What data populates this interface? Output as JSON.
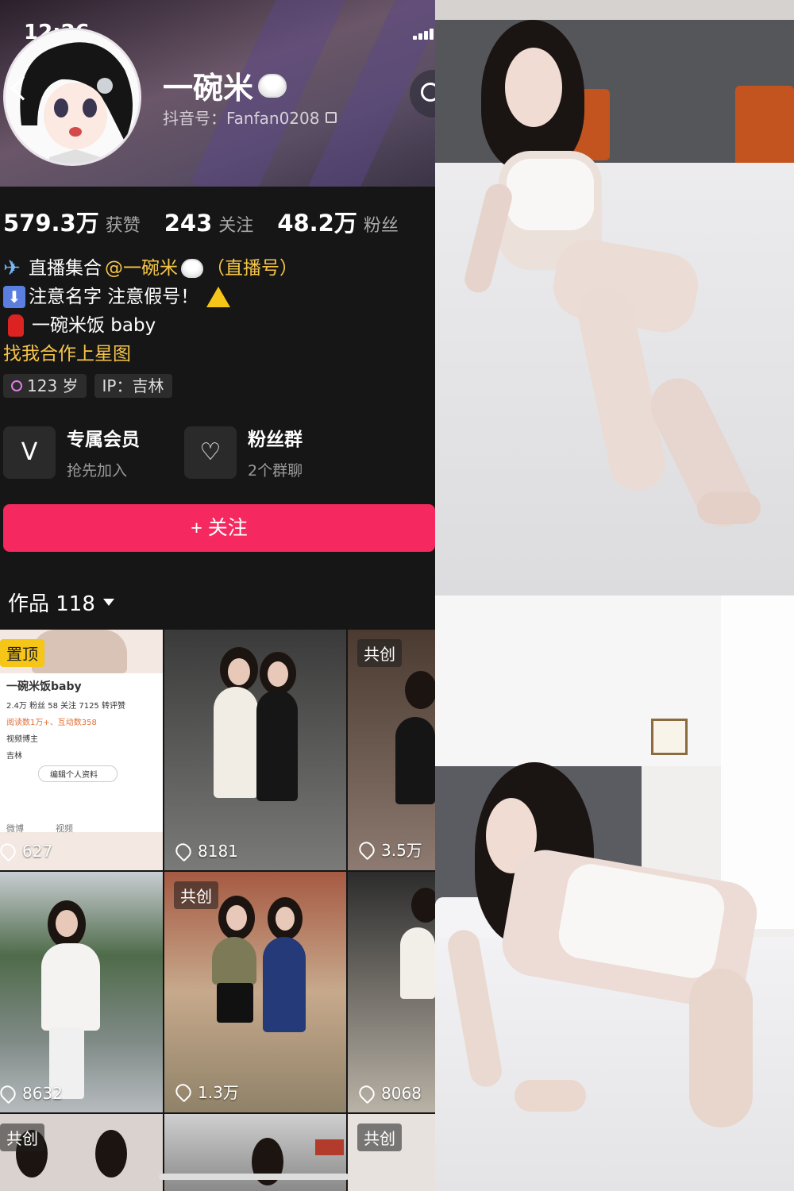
{
  "status_bar": {
    "time": "12:26"
  },
  "profile": {
    "username": "一碗米",
    "douyin_id_label": "抖音号：Fanfan0208",
    "stats": [
      {
        "value": "579.3万",
        "label": "获赞"
      },
      {
        "value": "243",
        "label": "关注"
      },
      {
        "value": "48.2万",
        "label": "粉丝"
      }
    ],
    "bio": {
      "line1_prefix": "直播集合",
      "line1_mention": "@一碗米",
      "line1_suffix": "（直播号）",
      "line2": "注意名字 注意假号！",
      "line3": "一碗米饭 baby",
      "line4": "找我合作上星图"
    },
    "tags": {
      "age": "123 岁",
      "ip": "IP：吉林"
    }
  },
  "cards": [
    {
      "title": "专属会员",
      "subtitle": "抢先加入"
    },
    {
      "title": "粉丝群",
      "subtitle": "2个群聊"
    }
  ],
  "follow_button": "+ 关注",
  "works": {
    "title": "作品 118"
  },
  "grid": [
    {
      "badge": "置顶",
      "likes": "627"
    },
    {
      "badge": "",
      "likes": "8181"
    },
    {
      "badge": "共创",
      "likes": "3.5万"
    },
    {
      "badge": "",
      "likes": "8632"
    },
    {
      "badge": "共创",
      "likes": "1.3万"
    },
    {
      "badge": "",
      "likes": "8068"
    },
    {
      "badge": "共创",
      "likes": ""
    },
    {
      "badge": "",
      "likes": ""
    },
    {
      "badge": "共创",
      "likes": ""
    }
  ],
  "mini_profile": {
    "name": "一碗米饭baby",
    "stats": "2.4万 粉丝  58 关注  7125 转评赞",
    "line1": "阅读数1万+、互动数358",
    "line2": "视频博主",
    "line3": "吉林",
    "edit": "编辑个人资料",
    "weibo": "微博",
    "video": "视频"
  },
  "colors": {
    "follow": "#f5295f",
    "accent_yellow": "#f5c548",
    "background": "#161616"
  }
}
